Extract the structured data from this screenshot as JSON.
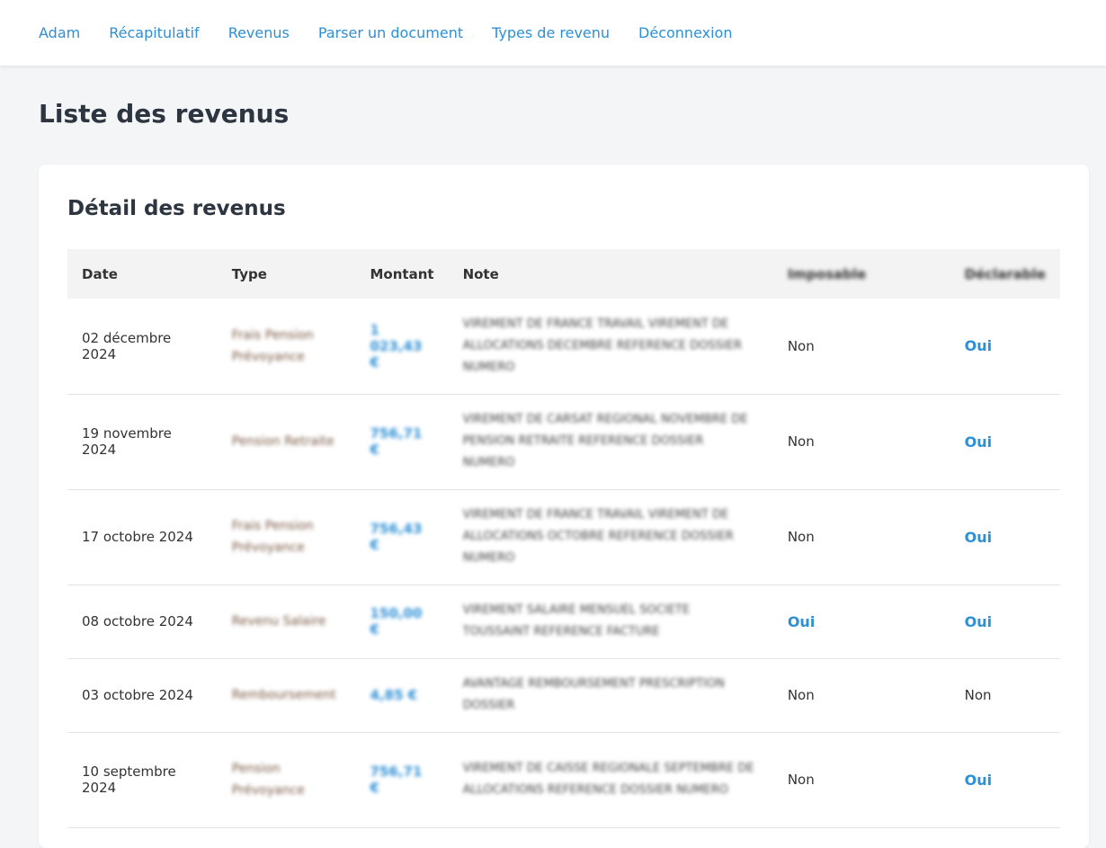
{
  "nav": {
    "items": [
      "Adam",
      "Récapitulatif",
      "Revenus",
      "Parser un document",
      "Types de revenu",
      "Déconnexion"
    ]
  },
  "page_title": "Liste des revenus",
  "card_title": "Détail des revenus",
  "table": {
    "headers": {
      "date": "Date",
      "type": "Type",
      "amount": "Montant",
      "note": "Note",
      "col5": "Imposable",
      "col6": "Déclarable"
    },
    "rows": [
      {
        "date": "02 décembre 2024",
        "type": "Frais Pension Prévoyance",
        "amount": "1 023,43 €",
        "note": "VIREMENT DE FRANCE TRAVAIL VIREMENT DE ALLOCATIONS DECEMBRE REFERENCE DOSSIER NUMERO",
        "col5": "Non",
        "col6": "Oui"
      },
      {
        "date": "19 novembre 2024",
        "type": "Pension Retraite",
        "amount": "756,71 €",
        "note": "VIREMENT DE CARSAT REGIONAL NOVEMBRE DE PENSION RETRAITE REFERENCE DOSSIER NUMERO",
        "col5": "Non",
        "col6": "Oui"
      },
      {
        "date": "17 octobre 2024",
        "type": "Frais Pension Prévoyance",
        "amount": "756,43 €",
        "note": "VIREMENT DE FRANCE TRAVAIL VIREMENT DE ALLOCATIONS OCTOBRE REFERENCE DOSSIER NUMERO",
        "col5": "Non",
        "col6": "Oui"
      },
      {
        "date": "08 octobre 2024",
        "type": "Revenu Salaire",
        "amount": "150,00 €",
        "note": "VIREMENT SALAIRE MENSUEL SOCIETE TOUSSAINT REFERENCE FACTURE",
        "col5": "Oui",
        "col6": "Oui"
      },
      {
        "date": "03 octobre 2024",
        "type": "Remboursement",
        "amount": "4,85 €",
        "note": "AVANTAGE REMBOURSEMENT PRESCRIPTION DOSSIER",
        "col5": "Non",
        "col6": "Non"
      },
      {
        "date": "10 septembre 2024",
        "type": "Pension Prévoyance",
        "amount": "756,71 €",
        "note": "VIREMENT DE CAISSE REGIONALE SEPTEMBRE DE ALLOCATIONS REFERENCE DOSSIER NUMERO",
        "col5": "Non",
        "col6": "Oui"
      }
    ]
  },
  "colors": {
    "link": "#2d8fd5",
    "background": "#f4f5f7",
    "title": "#2c3540"
  }
}
